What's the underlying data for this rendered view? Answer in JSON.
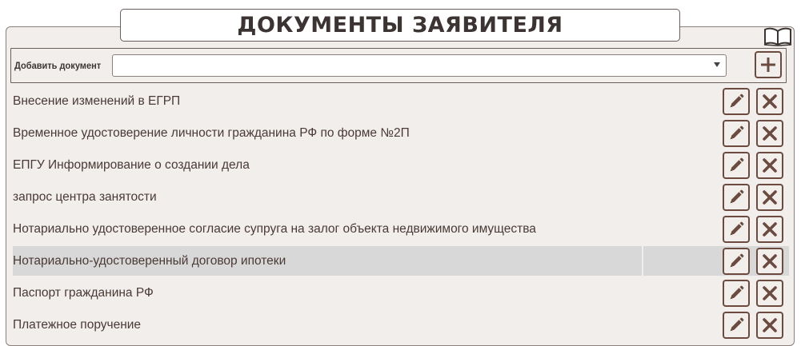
{
  "header": {
    "title": "ДОКУМЕНТЫ ЗАЯВИТЕЛЯ"
  },
  "add_document": {
    "label": "Добавить документ",
    "selected_value": ""
  },
  "documents": [
    {
      "label": "Внесение изменений в ЕГРП",
      "selected": false
    },
    {
      "label": "Временное удостоверение личности гражданина РФ по форме №2П",
      "selected": false
    },
    {
      "label": "ЕПГУ Информирование о создании дела",
      "selected": false
    },
    {
      "label": "запрос центра занятости",
      "selected": false
    },
    {
      "label": "Нотариально удостоверенное согласие супруга на залог объекта недвижимого имущества",
      "selected": false
    },
    {
      "label": "Нотариально-удостоверенный договор ипотеки",
      "selected": true
    },
    {
      "label": "Паспорт гражданина РФ",
      "selected": false
    },
    {
      "label": "Платежное поручение",
      "selected": false
    }
  ],
  "icons": {
    "help": "book-icon",
    "add": "plus-icon",
    "edit": "pencil-icon",
    "delete": "close-icon"
  },
  "colors": {
    "accent": "#6b4a40",
    "text": "#4a3a36",
    "panel_background": "#f1eeec",
    "selected_row": "#d9d8d8"
  }
}
